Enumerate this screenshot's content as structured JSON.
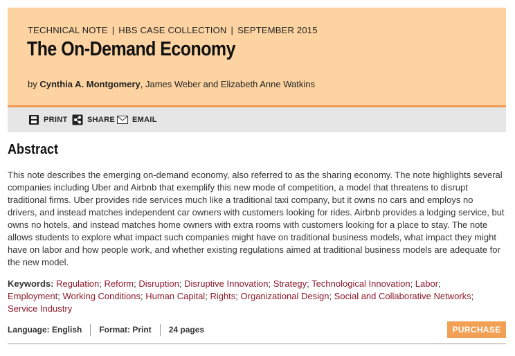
{
  "header": {
    "kicker": [
      "TECHNICAL NOTE",
      "HBS CASE COLLECTION",
      "SEPTEMBER 2015"
    ],
    "kicker_sep": "|",
    "title": "The On-Demand Economy",
    "byline_prefix": "by ",
    "author_primary": "Cynthia A. Montgomery",
    "authors_rest": ", James Weber and Elizabeth Anne Watkins"
  },
  "toolbar": {
    "print_label": "PRINT",
    "share_label": "SHARE",
    "email_label": "EMAIL"
  },
  "abstract": {
    "heading": "Abstract",
    "text": "This note describes the emerging on-demand economy, also referred to as the sharing economy. The note highlights several companies including Uber and Airbnb that exemplify this new mode of competition, a model that threatens to disrupt traditional firms. Uber provides ride services much like a traditional taxi company, but it owns no cars and employs no drivers, and instead matches independent car owners with customers looking for rides. Airbnb provides a lodging service, but owns no hotels, and instead matches home owners with extra rooms with customers looking for a place to stay. The note allows students to explore what impact such companies might have on traditional business models, what impact they might have on labor and how people work, and whether existing regulations aimed at traditional business models are adequate for the new model."
  },
  "keywords": {
    "label": "Keywords:",
    "items": [
      "Regulation",
      "Reform",
      "Disruption",
      "Disruptive Innovation",
      "Strategy",
      "Technological Innovation",
      "Labor",
      "Employment",
      "Working Conditions",
      "Human Capital",
      "Rights",
      "Organizational Design",
      "Social and Collaborative Networks",
      "Service Industry"
    ]
  },
  "meta": {
    "language": "Language: English",
    "format": "Format: Print",
    "pages": "24 pages"
  },
  "purchase_label": "PURCHASE",
  "colors": {
    "header_bg": "#fcd3a1",
    "header_rule": "#ef9a53",
    "link": "#8b1a2b",
    "purchase_bg": "#f2a154"
  }
}
